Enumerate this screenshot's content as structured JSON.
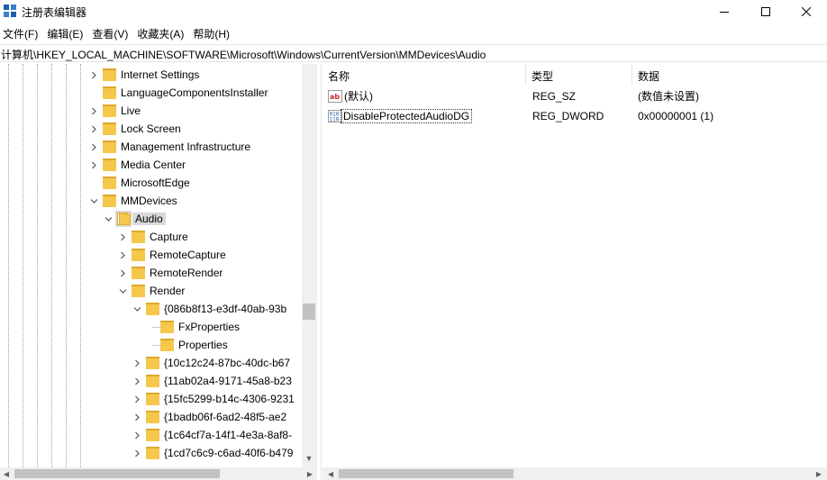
{
  "window": {
    "title": "注册表编辑器",
    "controls": {
      "minimize": "minimize",
      "maximize": "maximize",
      "close": "close"
    }
  },
  "menu": {
    "items": [
      "文件(F)",
      "编辑(E)",
      "查看(V)",
      "收藏夹(A)",
      "帮助(H)"
    ]
  },
  "address": "计算机\\HKEY_LOCAL_MACHINE\\SOFTWARE\\Microsoft\\Windows\\CurrentVersion\\MMDevices\\Audio",
  "tree": {
    "items": [
      {
        "label": "Internet Settings",
        "depth": 0,
        "state": "collapsed"
      },
      {
        "label": "LanguageComponentsInstaller",
        "depth": 0,
        "state": "none"
      },
      {
        "label": "Live",
        "depth": 0,
        "state": "collapsed"
      },
      {
        "label": "Lock Screen",
        "depth": 0,
        "state": "collapsed"
      },
      {
        "label": "Management Infrastructure",
        "depth": 0,
        "state": "collapsed"
      },
      {
        "label": "Media Center",
        "depth": 0,
        "state": "collapsed"
      },
      {
        "label": "MicrosoftEdge",
        "depth": 0,
        "state": "none"
      },
      {
        "label": "MMDevices",
        "depth": 0,
        "state": "expanded"
      },
      {
        "label": "Audio",
        "depth": 1,
        "state": "expanded",
        "selected": true
      },
      {
        "label": "Capture",
        "depth": 2,
        "state": "collapsed"
      },
      {
        "label": "RemoteCapture",
        "depth": 2,
        "state": "collapsed"
      },
      {
        "label": "RemoteRender",
        "depth": 2,
        "state": "collapsed"
      },
      {
        "label": "Render",
        "depth": 2,
        "state": "expanded"
      },
      {
        "label": "{086b8f13-e3df-40ab-93b",
        "depth": 3,
        "state": "expanded"
      },
      {
        "label": "FxProperties",
        "depth": 4,
        "state": "none"
      },
      {
        "label": "Properties",
        "depth": 4,
        "state": "none"
      },
      {
        "label": "{10c12c24-87bc-40dc-b67",
        "depth": 3,
        "state": "collapsed"
      },
      {
        "label": "{11ab02a4-9171-45a8-b23",
        "depth": 3,
        "state": "collapsed"
      },
      {
        "label": "{15fc5299-b14c-4306-9231",
        "depth": 3,
        "state": "collapsed"
      },
      {
        "label": "{1badb06f-6ad2-48f5-ae2",
        "depth": 3,
        "state": "collapsed"
      },
      {
        "label": "{1c64cf7a-14f1-4e3a-8af8-",
        "depth": 3,
        "state": "collapsed"
      },
      {
        "label": "{1cd7c6c9-c6ad-40f6-b479",
        "depth": 3,
        "state": "collapsed"
      }
    ]
  },
  "list": {
    "columns": [
      "名称",
      "类型",
      "数据"
    ],
    "rows": [
      {
        "name": "(默认)",
        "type": "REG_SZ",
        "data": "(数值未设置)",
        "icon": "string-value-icon"
      },
      {
        "name": "DisableProtectedAudioDG",
        "type": "REG_DWORD",
        "data": "0x00000001 (1)",
        "icon": "binary-value-icon"
      }
    ]
  },
  "colors": {
    "folder": "#f5c84c",
    "folder_dark": "#dca92a",
    "selection": "#d9d9d9",
    "scroll_track": "#f0f0f0",
    "scroll_thumb": "#c2c2c2",
    "string_icon_red": "#c8322d",
    "binary_icon_blue": "#1c5fa8"
  }
}
